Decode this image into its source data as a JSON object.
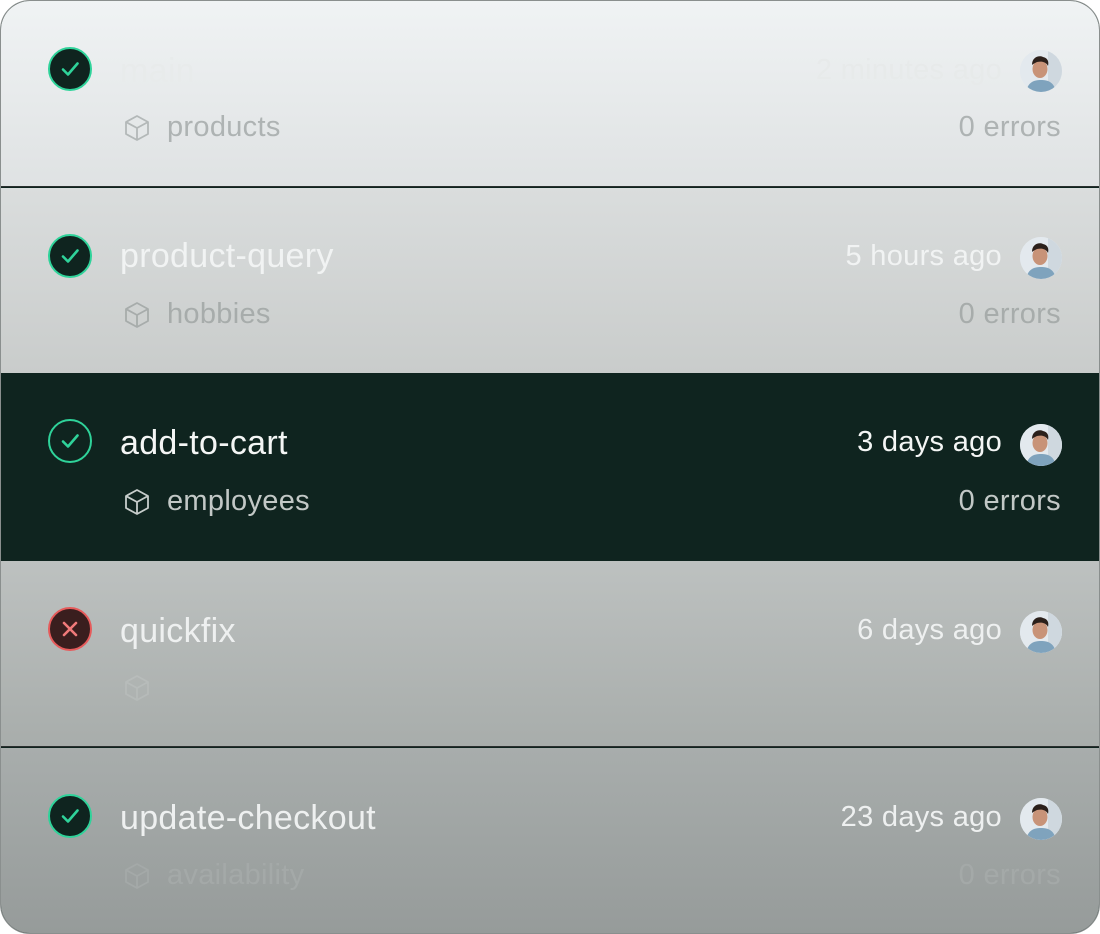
{
  "deployments": [
    {
      "branch": "main",
      "time": "2 minutes ago",
      "package": "products",
      "errors": "0 errors",
      "status": "success",
      "status_icon": "check-icon"
    },
    {
      "branch": "product-query",
      "time": "5 hours ago",
      "package": "hobbies",
      "errors": "0 errors",
      "status": "success",
      "status_icon": "check-icon"
    },
    {
      "branch": "add-to-cart",
      "time": "3 days ago",
      "package": "employees",
      "errors": "0 errors",
      "status": "success",
      "status_icon": "check-icon"
    },
    {
      "branch": "quickfix",
      "time": "6 days ago",
      "package": "",
      "errors": "",
      "status": "failed",
      "status_icon": "x-icon"
    },
    {
      "branch": "update-checkout",
      "time": "23 days ago",
      "package": "availability",
      "errors": "0 errors",
      "status": "success",
      "status_icon": "check-icon"
    }
  ],
  "colors": {
    "success": "#2fd39a",
    "failed": "#e65b5b",
    "selected_bg": "#0f241f"
  }
}
